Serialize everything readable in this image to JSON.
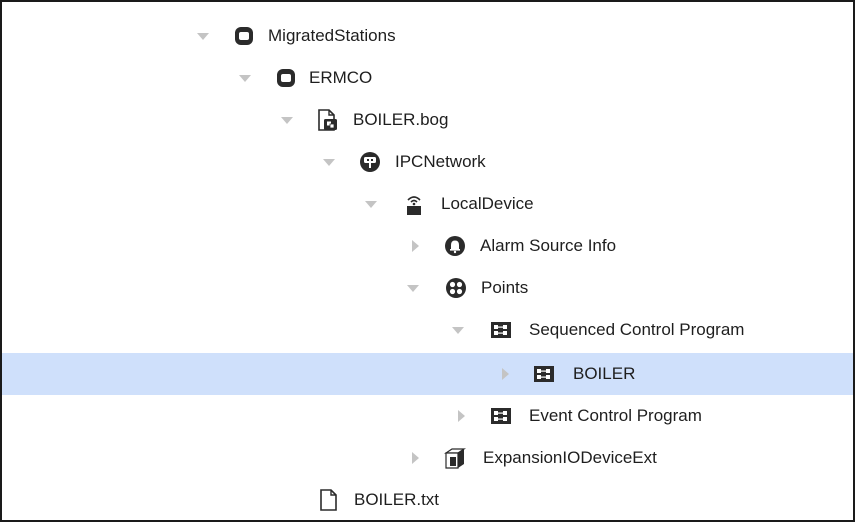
{
  "tree": {
    "nodes": [
      {
        "label": "MigratedStations",
        "icon": "station-folder-icon",
        "state": "expanded"
      },
      {
        "label": "ERMCO",
        "icon": "station-folder-icon",
        "state": "expanded"
      },
      {
        "label": "BOILER.bog",
        "icon": "bog-file-icon",
        "state": "expanded"
      },
      {
        "label": "IPCNetwork",
        "icon": "network-icon",
        "state": "expanded"
      },
      {
        "label": "LocalDevice",
        "icon": "device-icon",
        "state": "expanded"
      },
      {
        "label": "Alarm Source Info",
        "icon": "alarm-icon",
        "state": "collapsed"
      },
      {
        "label": "Points",
        "icon": "points-icon",
        "state": "expanded"
      },
      {
        "label": "Sequenced Control Program",
        "icon": "program-icon",
        "state": "expanded"
      },
      {
        "label": "BOILER",
        "icon": "program-icon",
        "state": "collapsed",
        "selected": true
      },
      {
        "label": "Event Control Program",
        "icon": "program-icon",
        "state": "collapsed"
      },
      {
        "label": "ExpansionIODeviceExt",
        "icon": "extension-icon",
        "state": "collapsed"
      },
      {
        "label": "BOILER.txt",
        "icon": "text-file-icon",
        "state": "leaf"
      }
    ]
  },
  "colors": {
    "selection": "#cfe0fb",
    "arrow": "#c4c4c4",
    "icon": "#2b2b2b",
    "border": "#1a1a1a"
  }
}
